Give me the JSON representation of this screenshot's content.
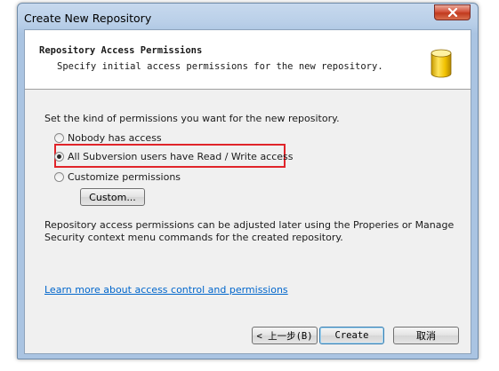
{
  "window": {
    "title": "Create New Repository"
  },
  "header": {
    "title": "Repository Access Permissions",
    "subtitle": "Specify initial access permissions for the new repository."
  },
  "body": {
    "prompt": "Set the kind of permissions you want for the new repository.",
    "options": [
      {
        "label": "Nobody has access",
        "selected": false
      },
      {
        "label": "All Subversion users have Read / Write access",
        "selected": true
      },
      {
        "label": "Customize permissions",
        "selected": false
      }
    ],
    "custom_button": "Custom...",
    "note": "Repository access permissions can be adjusted later using the Properies or Manage Security context menu commands for the created repository.",
    "link": "Learn more about access control and permissions"
  },
  "footer": {
    "back_button": "< 上一步(B)",
    "create_button": "Create",
    "cancel_button": "取消"
  },
  "colors": {
    "highlight": "#e0242a",
    "link": "#0066cc"
  },
  "icons": {
    "close": "close-icon",
    "database": "database-icon"
  }
}
